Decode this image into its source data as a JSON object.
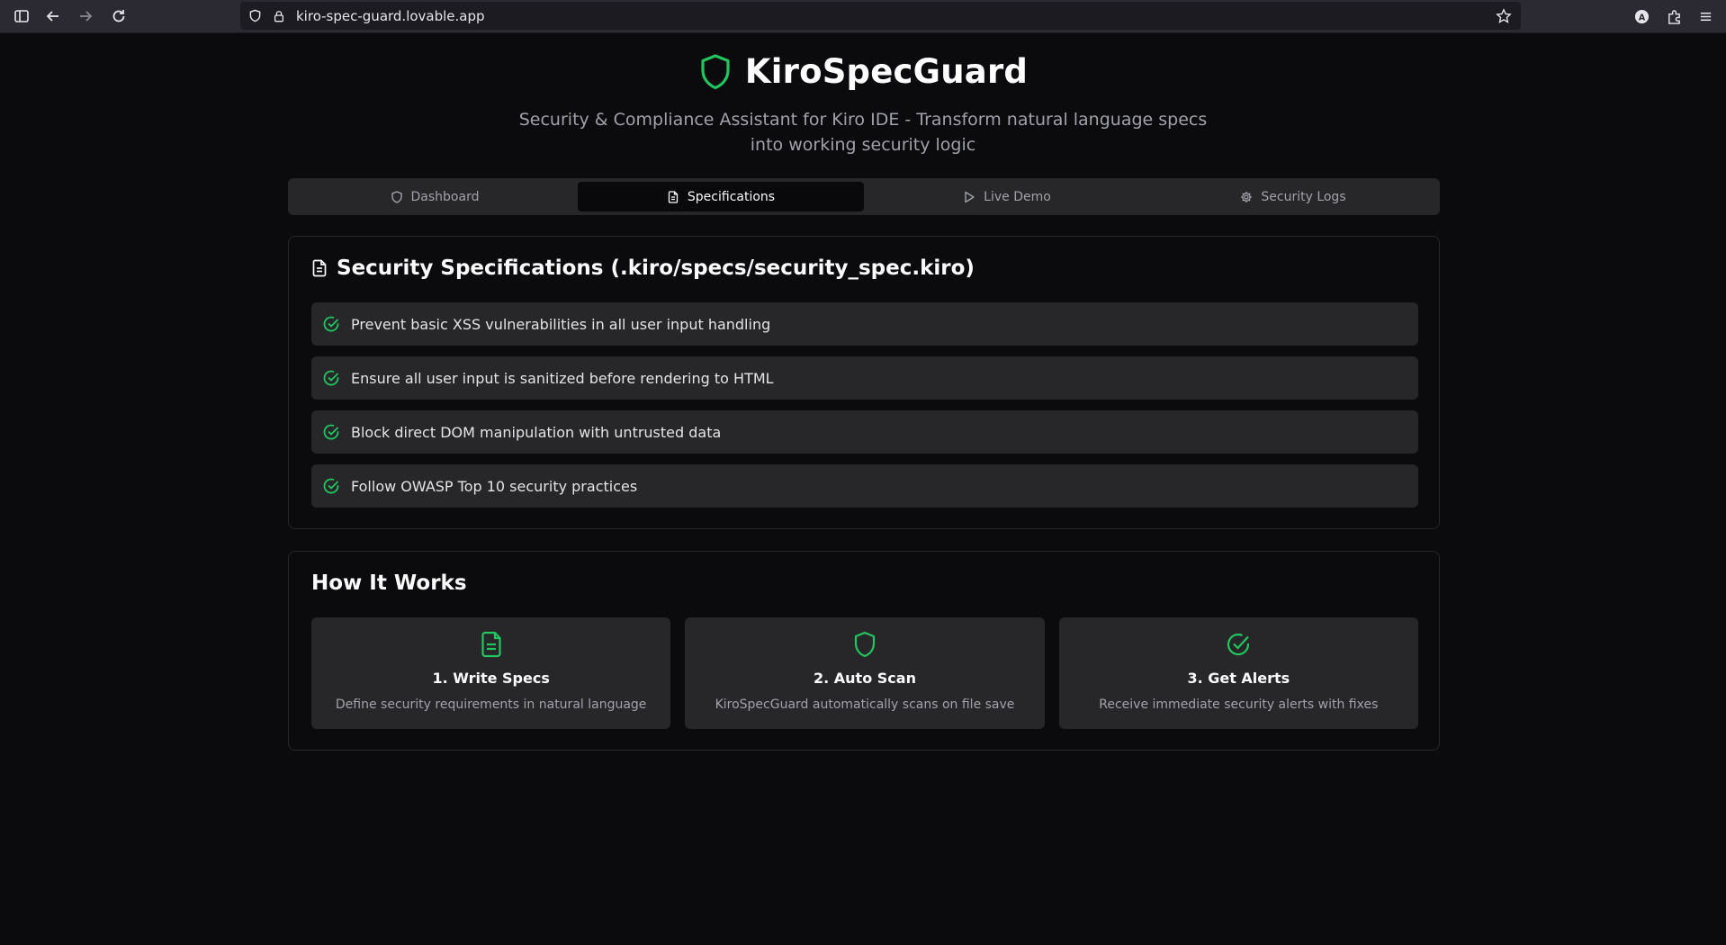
{
  "browser": {
    "url": "kiro-spec-guard.lovable.app",
    "account_initial": "A"
  },
  "header": {
    "title": "KiroSpecGuard",
    "subtitle": "Security & Compliance Assistant for Kiro IDE - Transform natural language specs into working security logic"
  },
  "tabs": [
    {
      "label": "Dashboard",
      "icon": "shield-icon"
    },
    {
      "label": "Specifications",
      "icon": "document-icon",
      "active": true
    },
    {
      "label": "Live Demo",
      "icon": "play-icon"
    },
    {
      "label": "Security Logs",
      "icon": "gear-icon"
    }
  ],
  "specs": {
    "title": "Security Specifications (.kiro/specs/security_spec.kiro)",
    "items": [
      "Prevent basic XSS vulnerabilities in all user input handling",
      "Ensure all user input is sanitized before rendering to HTML",
      "Block direct DOM manipulation with untrusted data",
      "Follow OWASP Top 10 security practices"
    ]
  },
  "how": {
    "title": "How It Works",
    "steps": [
      {
        "title": "1. Write Specs",
        "desc": "Define security requirements in natural language",
        "icon": "document-icon"
      },
      {
        "title": "2. Auto Scan",
        "desc": "KiroSpecGuard automatically scans on file save",
        "icon": "shield-icon"
      },
      {
        "title": "3. Get Alerts",
        "desc": "Receive immediate security alerts with fixes",
        "icon": "check-circle-icon"
      }
    ]
  },
  "colors": {
    "accent": "#22c55e",
    "background": "#0b0b0d",
    "surface": "#27272a"
  }
}
